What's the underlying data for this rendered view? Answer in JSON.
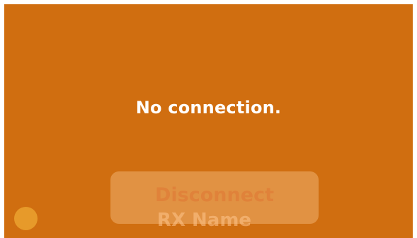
{
  "screen": {
    "message": "No connection.",
    "disconnect_label": "Disconnect",
    "rx_name": "RX Name",
    "status_indicator_icon": "status-dot-icon",
    "colors": {
      "background": "#d06e10",
      "button_fill": "#f6be82",
      "status_dot": "#e79a2a",
      "text": "#ffffff"
    }
  }
}
